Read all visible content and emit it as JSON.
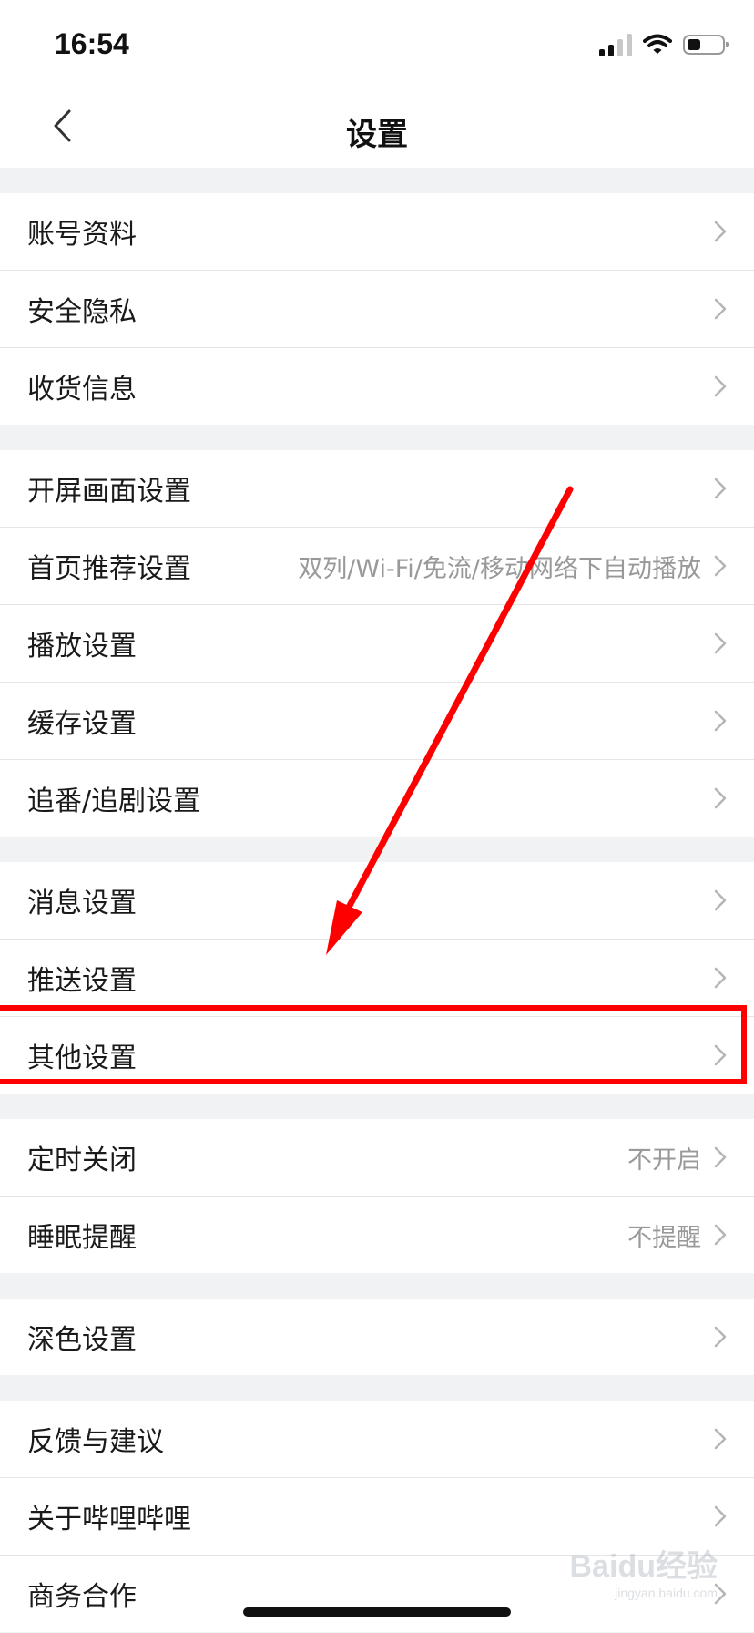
{
  "status_bar": {
    "time": "16:54"
  },
  "header": {
    "title": "设置"
  },
  "groups": [
    {
      "rows": [
        {
          "label": "账号资料",
          "value": ""
        },
        {
          "label": "安全隐私",
          "value": ""
        },
        {
          "label": "收货信息",
          "value": ""
        }
      ]
    },
    {
      "rows": [
        {
          "label": "开屏画面设置",
          "value": ""
        },
        {
          "label": "首页推荐设置",
          "value": "双列/Wi-Fi/免流/移动网络下自动播放"
        },
        {
          "label": "播放设置",
          "value": ""
        },
        {
          "label": "缓存设置",
          "value": ""
        },
        {
          "label": "追番/追剧设置",
          "value": ""
        }
      ]
    },
    {
      "rows": [
        {
          "label": "消息设置",
          "value": ""
        },
        {
          "label": "推送设置",
          "value": ""
        },
        {
          "label": "其他设置",
          "value": ""
        }
      ]
    },
    {
      "rows": [
        {
          "label": "定时关闭",
          "value": "不开启"
        },
        {
          "label": "睡眠提醒",
          "value": "不提醒"
        }
      ]
    },
    {
      "rows": [
        {
          "label": "深色设置",
          "value": ""
        }
      ]
    },
    {
      "rows": [
        {
          "label": "反馈与建议",
          "value": ""
        },
        {
          "label": "关于哔哩哔哩",
          "value": ""
        },
        {
          "label": "商务合作",
          "value": ""
        }
      ]
    }
  ],
  "annotation": {
    "color": "#ff0000"
  },
  "watermark": {
    "main": "Baidu经验",
    "sub": "jingyan.baidu.com"
  }
}
